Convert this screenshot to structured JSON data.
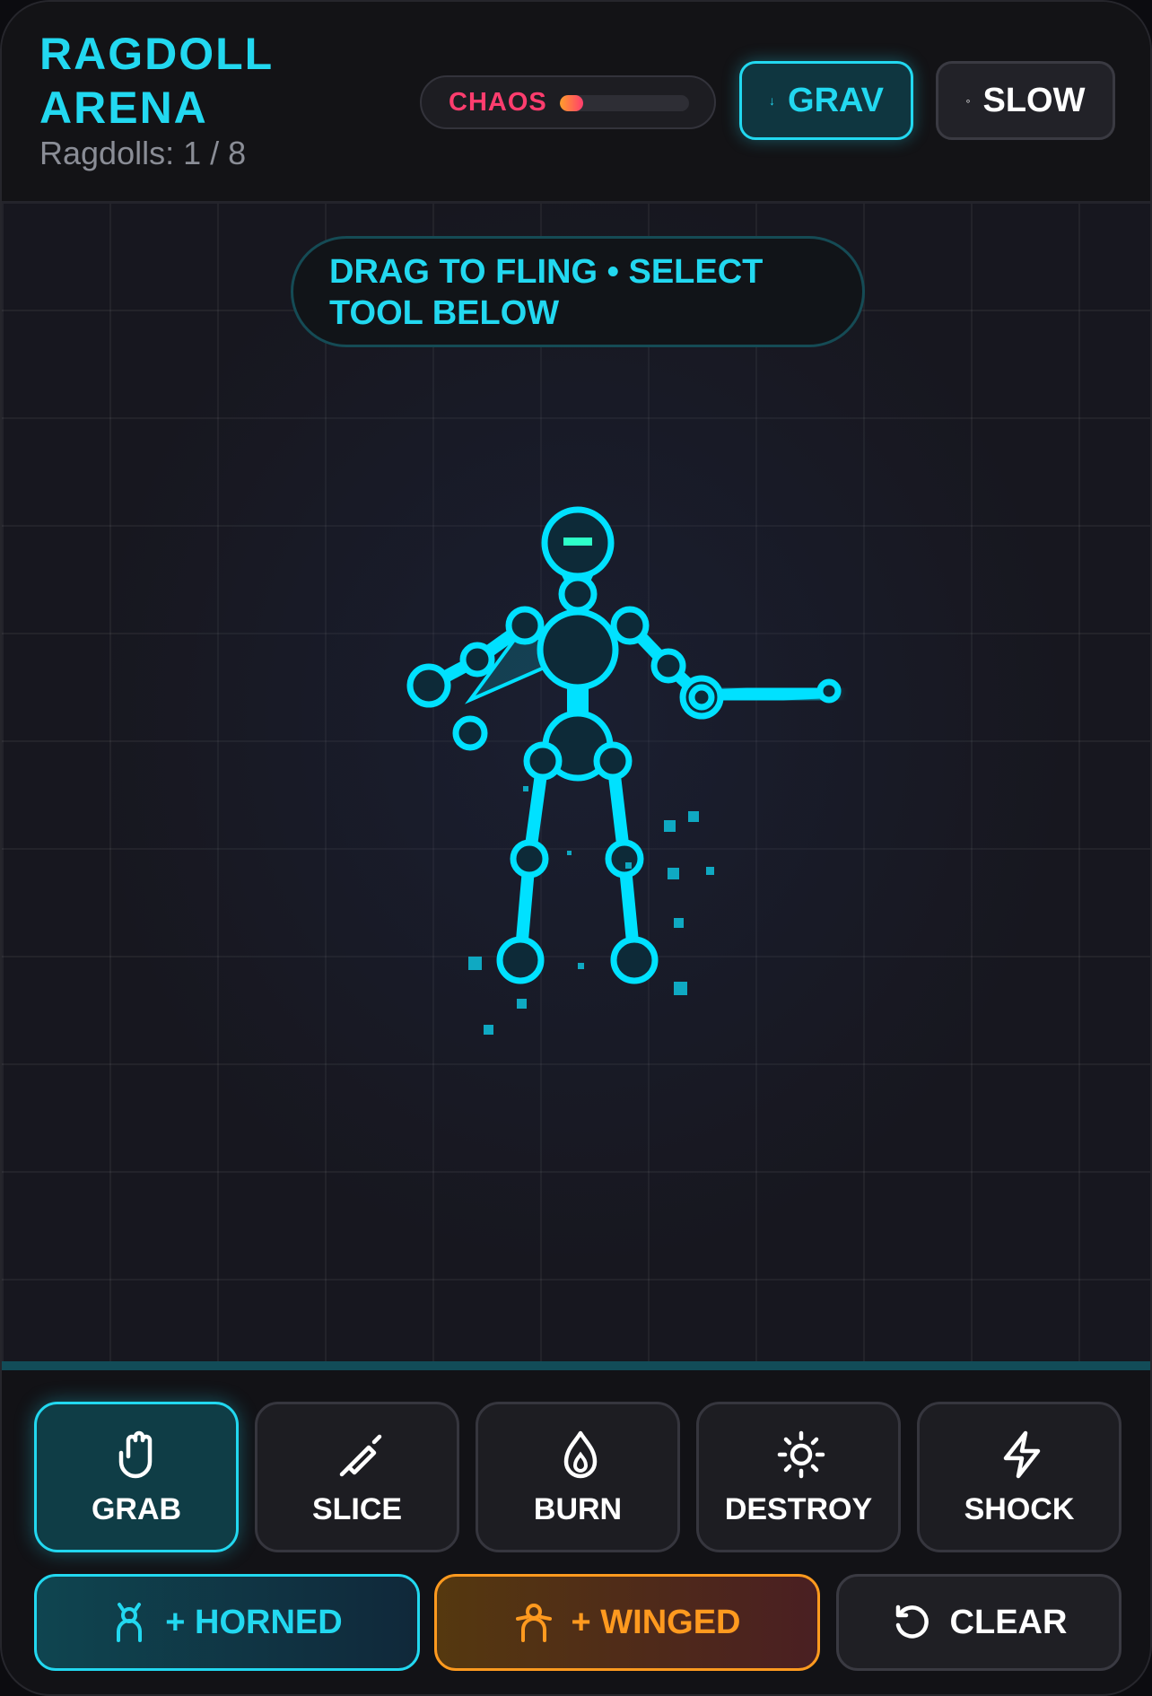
{
  "header": {
    "title": "RAGDOLL ARENA",
    "ragdoll_count": "Ragdolls: 1 / 8",
    "chaos_label": "CHAOS",
    "chaos_level": 0.18,
    "grav_label": "GRAV",
    "slow_label": "SLOW"
  },
  "arena": {
    "hint": "DRAG TO FLING • SELECT TOOL BELOW"
  },
  "tools": [
    {
      "label": "GRAB",
      "icon": "hand-icon",
      "active": true
    },
    {
      "label": "SLICE",
      "icon": "knife-icon",
      "active": false
    },
    {
      "label": "BURN",
      "icon": "flame-icon",
      "active": false
    },
    {
      "label": "DESTROY",
      "icon": "sun-icon",
      "active": false
    },
    {
      "label": "SHOCK",
      "icon": "lightning-icon",
      "active": false
    }
  ],
  "spawn": {
    "horned_label": "+ HORNED",
    "winged_label": "+ WINGED",
    "clear_label": "CLEAR"
  },
  "colors": {
    "accent": "#22d8f0",
    "chaos": "#ff3d6e",
    "winged": "#ff9a1f"
  }
}
